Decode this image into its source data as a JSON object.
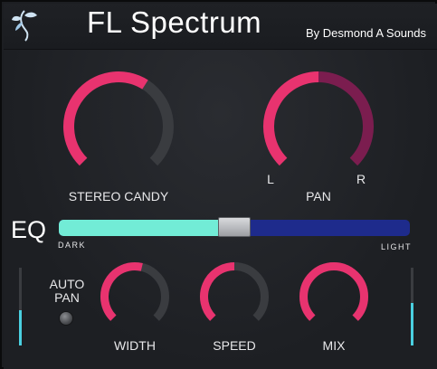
{
  "header": {
    "title": "FL Spectrum",
    "byline": "By Desmond A Sounds",
    "logo": "fruit-logo-icon"
  },
  "knobs": {
    "stereo_candy": {
      "label": "STEREO CANDY",
      "value": 0.62
    },
    "pan": {
      "label": "PAN",
      "left_label": "L",
      "right_label": "R",
      "value": 0.5
    },
    "width": {
      "label": "WIDTH",
      "value": 0.55
    },
    "speed": {
      "label": "SPEED",
      "value": 0.5
    },
    "mix": {
      "label": "MIX",
      "value": 1.0
    }
  },
  "eq": {
    "label": "EQ",
    "left_label": "DARK",
    "right_label": "LIGHT",
    "value": 0.5
  },
  "auto_pan": {
    "label": "AUTO PAN",
    "enabled": false
  },
  "meters": {
    "left_level": 0.45,
    "right_level": 0.55
  },
  "colors": {
    "accent": "#e8336f",
    "pan_right": "#7b1d4f",
    "track": "#3a3c40",
    "eq_fill": "#72ecd6",
    "eq_track": "#1e2b8c",
    "meter": "#4ad0e0"
  }
}
